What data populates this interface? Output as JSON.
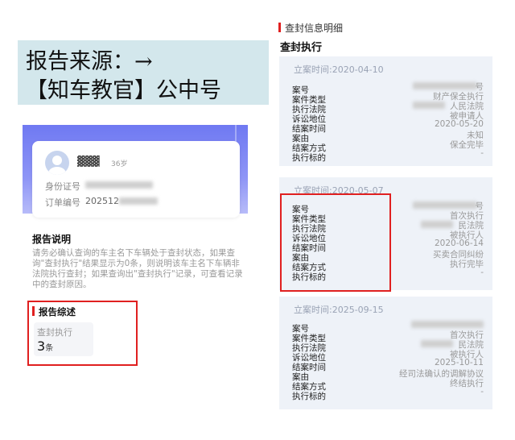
{
  "banner": {
    "line1": "报告来源：→",
    "line2": "【知车教官】公中号"
  },
  "profile": {
    "name": "▓▓▓",
    "age": "36岁",
    "id_label": "身份证号",
    "order_label": "订单编号",
    "order_prefix": "202512"
  },
  "report_note": {
    "title": "报告说明",
    "text": "请务必确认查询的车主名下车辆处于查封状态，如果查询\"查封执行\"结果显示为0条，则说明该车主名下车辆非法院执行查封；如果查询出\"查封执行\"记录，可查看记录中的查封原因。"
  },
  "summary": {
    "title": "报告综述",
    "item_label": "查封执行",
    "count": "3",
    "unit": "条"
  },
  "detail": {
    "section_title": "查封信息明细",
    "sub_title": "查封执行",
    "records": [
      {
        "date": "立案时间:2020-04-10",
        "rows": [
          {
            "label": "案号",
            "value": "号"
          },
          {
            "label": "案件类型",
            "value": "财产保全执行"
          },
          {
            "label": "执行法院",
            "value": "人民法院"
          },
          {
            "label": "诉讼地位",
            "value": "被申请人"
          },
          {
            "label": "结案时间",
            "value": "2020-05-20"
          },
          {
            "label": "案由",
            "value": "未知"
          },
          {
            "label": "结案方式",
            "value": "保全完毕"
          },
          {
            "label": "执行标的",
            "value": "-"
          }
        ]
      },
      {
        "date": "立案时间:2020-05-07",
        "rows": [
          {
            "label": "案号",
            "value": "号"
          },
          {
            "label": "案件类型",
            "value": "首次执行"
          },
          {
            "label": "执行法院",
            "value": "民法院"
          },
          {
            "label": "诉讼地位",
            "value": "被执行人"
          },
          {
            "label": "结案时间",
            "value": "2020-06-14"
          },
          {
            "label": "案由",
            "value": "买卖合同纠纷"
          },
          {
            "label": "结案方式",
            "value": "执行完毕"
          },
          {
            "label": "执行标的",
            "value": "-"
          }
        ]
      },
      {
        "date": "立案时间:2025-09-15",
        "rows": [
          {
            "label": "案号",
            "value": ""
          },
          {
            "label": "案件类型",
            "value": "首次执行"
          },
          {
            "label": "执行法院",
            "value": "民法院"
          },
          {
            "label": "诉讼地位",
            "value": "被执行人"
          },
          {
            "label": "结案时间",
            "value": "2025-10-11"
          },
          {
            "label": "案由",
            "value": "经司法确认的调解协议"
          },
          {
            "label": "结案方式",
            "value": "终结执行"
          },
          {
            "label": "执行标的",
            "value": "-"
          }
        ]
      }
    ]
  }
}
